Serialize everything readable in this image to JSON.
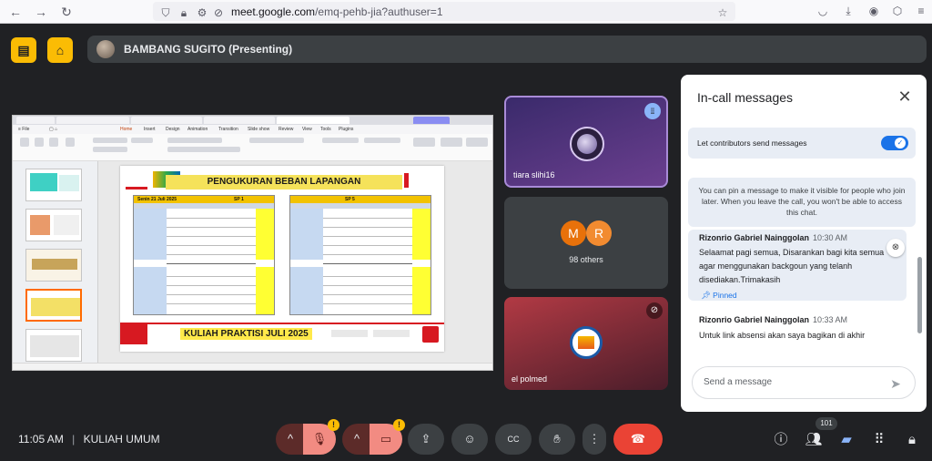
{
  "browser": {
    "url_main": "meet.google.com",
    "url_path": "/emq-pehb-jia?authuser=1"
  },
  "presenter": {
    "name": "BAMBANG SUGITO (Presenting)"
  },
  "slide": {
    "title": "PENGUKURAN BEBAN LAPANGAN",
    "table_date": "Senin 21 Juli 2025",
    "table1_header": "SP 1",
    "table2_header": "SP 5",
    "footer": "KULIAH PRAKTISI JULI 2025"
  },
  "tiles": [
    {
      "name": "tiara slihi16"
    },
    {
      "count_label": "98 others",
      "avatars": [
        "M",
        "R"
      ]
    },
    {
      "name": "el polmed"
    }
  ],
  "chat": {
    "title": "In-call messages",
    "toggle_label": "Let contributors send messages",
    "toggle_on": true,
    "info": "You can pin a message to make it visible for people who join later. When you leave the call, you won't be able to access this chat.",
    "messages": [
      {
        "sender": "Rizonrio Gabriel Nainggolan",
        "time": "10:30 AM",
        "text": "Selaamat pagi semua, Disarankan bagi kita semua agar menggunakan backgoun yang telanh disediakan.Trimakasih",
        "pinned_label": "Pinned"
      },
      {
        "sender": "Rizonrio Gabriel Nainggolan",
        "time": "10:33 AM",
        "text": "Untuk link absensi akan saya bagikan di akhir"
      }
    ],
    "send_placeholder": "Send a message"
  },
  "bottom": {
    "time": "11:05 AM",
    "meeting": "KULIAH UMUM",
    "people_count": "101"
  },
  "colors": {
    "accent": "#1a73e8",
    "end_call": "#ea4335",
    "warning": "#fbbc04"
  }
}
